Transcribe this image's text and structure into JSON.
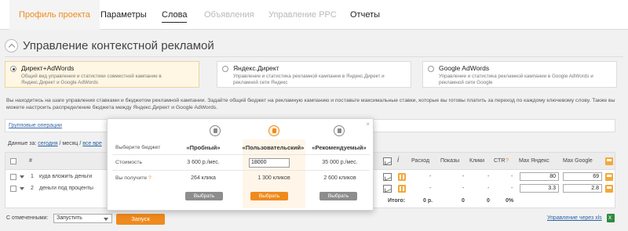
{
  "tabs": [
    "Профиль проекта",
    "Параметры",
    "Слова",
    "Объявления",
    "Управление PPC",
    "Отчеты"
  ],
  "page_title": "Управление контекстной рекламой",
  "options": [
    {
      "title": "Директ+AdWords",
      "desc": "Общий вид управления и статистики совместной кампании в Яндекс.Директ и Google AdWords"
    },
    {
      "title": "Яндекс.Директ",
      "desc": "Управление и статистика рекламной кампании в Яндекс.Директ и рекламной сети Яндекс"
    },
    {
      "title": "Google AdWords",
      "desc": "Управление и статистика рекламной кампании в Google AdWords и рекламной сети Google"
    }
  ],
  "info_text": "Вы находитесь на шаге управления ставками и бюджетом рекламной кампании. Задайте общий бюджет на рекламную кампанию и поставьте максимальные ставки, которые вы готовы платить за переход по каждому ключевому слову. Также вы можете настроить распределение бюджета между Яндекс.Директ и Google AdWords.",
  "group_ops": "Групповые операции",
  "data_for": {
    "label": "Данные за:",
    "today": "сегодня",
    "sep": "/ месяц /",
    "all": "все вре"
  },
  "table": {
    "headers": {
      "num": "#",
      "rashod": "Расход",
      "pokazy": "Показы",
      "kliki": "Клики",
      "ctr": "CTR",
      "ctr_q": "?",
      "max_yandex": "Max Яндекс",
      "max_google": "Max Google"
    },
    "rows": [
      {
        "num": "1",
        "keyword": "куда вложить деньги",
        "rashod": "-",
        "pokazy": "-",
        "kliki": "-",
        "ctr": "-",
        "max_yandex": "80",
        "max_google": "69"
      },
      {
        "num": "2",
        "keyword": "деньги под проценты",
        "rashod": "-",
        "pokazy": "-",
        "kliki": "-",
        "ctr": "-",
        "max_yandex": "3.3",
        "max_google": "2.8"
      }
    ],
    "totals": {
      "label": "Итого:",
      "rashod": "0 р.",
      "pokazy": "0",
      "kliki": "0",
      "ctr": "0%"
    }
  },
  "footer": {
    "label": "С отмеченными:",
    "select_value": "Запустить",
    "run": "Запуск",
    "xls": "Управление через xls"
  },
  "popup": {
    "close": "×",
    "labels": {
      "budget": "Выберите бюджет",
      "cost": "Стоимость",
      "get": "Вы получите",
      "get_q": "?"
    },
    "plans": [
      {
        "name": "«Пробный»",
        "cost": "3 600 р./мес.",
        "clicks": "264 клика",
        "button": "Выбрать"
      },
      {
        "name": "«Пользовательский»",
        "cost": "18000",
        "clicks": "1 300 кликов",
        "button": "Выбрать"
      },
      {
        "name": "«Рекомендуемый»",
        "cost": "35 000 р./мес.",
        "clicks": "2 600 кликов",
        "button": "Выбрать"
      }
    ]
  },
  "colors": {
    "accent": "#f08a1d"
  }
}
